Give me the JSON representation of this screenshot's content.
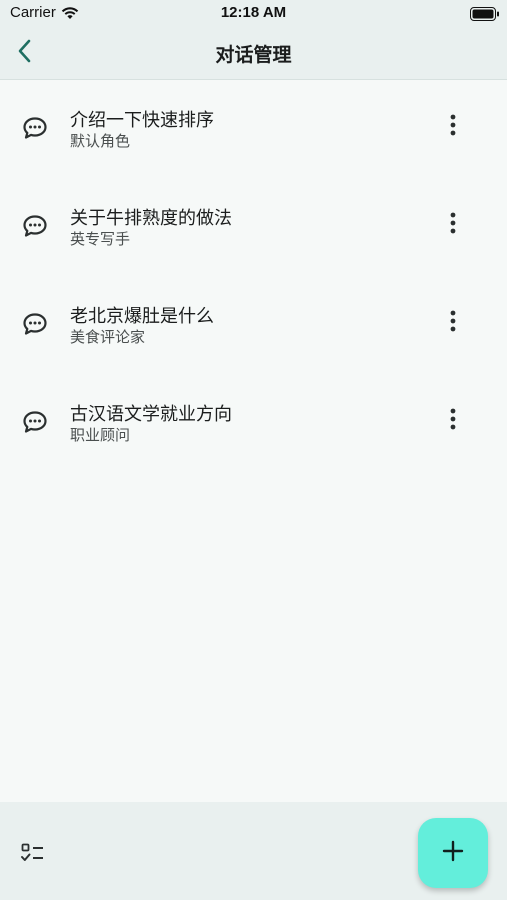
{
  "status_bar": {
    "carrier": "Carrier",
    "time": "12:18 AM",
    "wifi_icon": "wifi-icon",
    "battery_icon": "battery-icon"
  },
  "header": {
    "title": "对话管理",
    "back_icon": "chevron-left-icon",
    "accent_color": "#1f6f62"
  },
  "conversations": [
    {
      "title": "介绍一下快速排序",
      "role": "默认角色",
      "icon": "chat-bubble-icon",
      "menu_icon": "more-vertical-icon"
    },
    {
      "title": "关于牛排熟度的做法",
      "role": "英专写手",
      "icon": "chat-bubble-icon",
      "menu_icon": "more-vertical-icon"
    },
    {
      "title": "老北京爆肚是什么",
      "role": "美食评论家",
      "icon": "chat-bubble-icon",
      "menu_icon": "more-vertical-icon"
    },
    {
      "title": "古汉语文学就业方向",
      "role": "职业顾问",
      "icon": "chat-bubble-icon",
      "menu_icon": "more-vertical-icon"
    }
  ],
  "bottom_bar": {
    "select_icon": "checklist-icon",
    "add_icon": "plus-icon",
    "fab_color": "#63eedb"
  }
}
